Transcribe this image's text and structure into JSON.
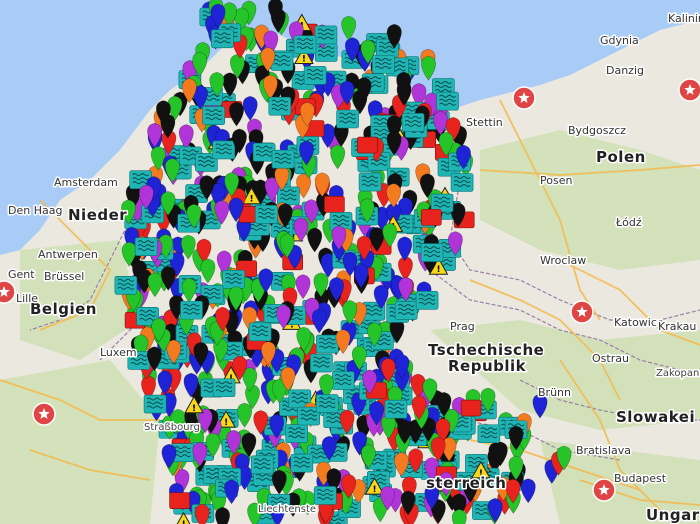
{
  "map": {
    "labels": {
      "polen": "Polen",
      "belgien": "Belgien",
      "nieder": "Nieder",
      "tschechische": "Tschechische",
      "republik": "Republik",
      "slowakei": "Slowakei",
      "ungarn": "Ungarn",
      "luxem": "Luxem",
      "oesterreich_partial": "sterreich",
      "lichtenstein_partial": "Liechtenste",
      "gdynia": "Gdynia",
      "danzig": "Danzig",
      "kalining": "Kalining",
      "stettin": "Stettin",
      "bydgoszcz": "Bydgoszcz",
      "posen": "Posen",
      "lodz": "Łódź",
      "wroclaw": "Wroclaw",
      "katowice": "Katowice",
      "krakau": "Krakau",
      "ostrau": "Ostrau",
      "zakopane": "Zakopane",
      "bratislava": "Bratislava",
      "budapest": "Budapest",
      "bruenn": "Brünn",
      "prag": "Prag",
      "amsterdam": "Amsterdam",
      "den_haag": "Den Haag",
      "antwerpen": "Antwerpen",
      "gent": "Gent",
      "bruessel": "Brüssel",
      "lille": "Lille",
      "strassbourg": "Straßbourg"
    },
    "colors": {
      "sea": "#a8ccf6",
      "land": "#ebe8df",
      "forest": "#cfe2b6",
      "marker_blue": "#1f23d6",
      "marker_green": "#25c428",
      "marker_black": "#111111",
      "marker_red": "#e8231d",
      "marker_orange": "#f47a1f",
      "marker_teal": "#20b5b5",
      "marker_purple": "#b034d8",
      "warning_yellow": "#f8d71b",
      "poi_red": "#e04545"
    }
  }
}
